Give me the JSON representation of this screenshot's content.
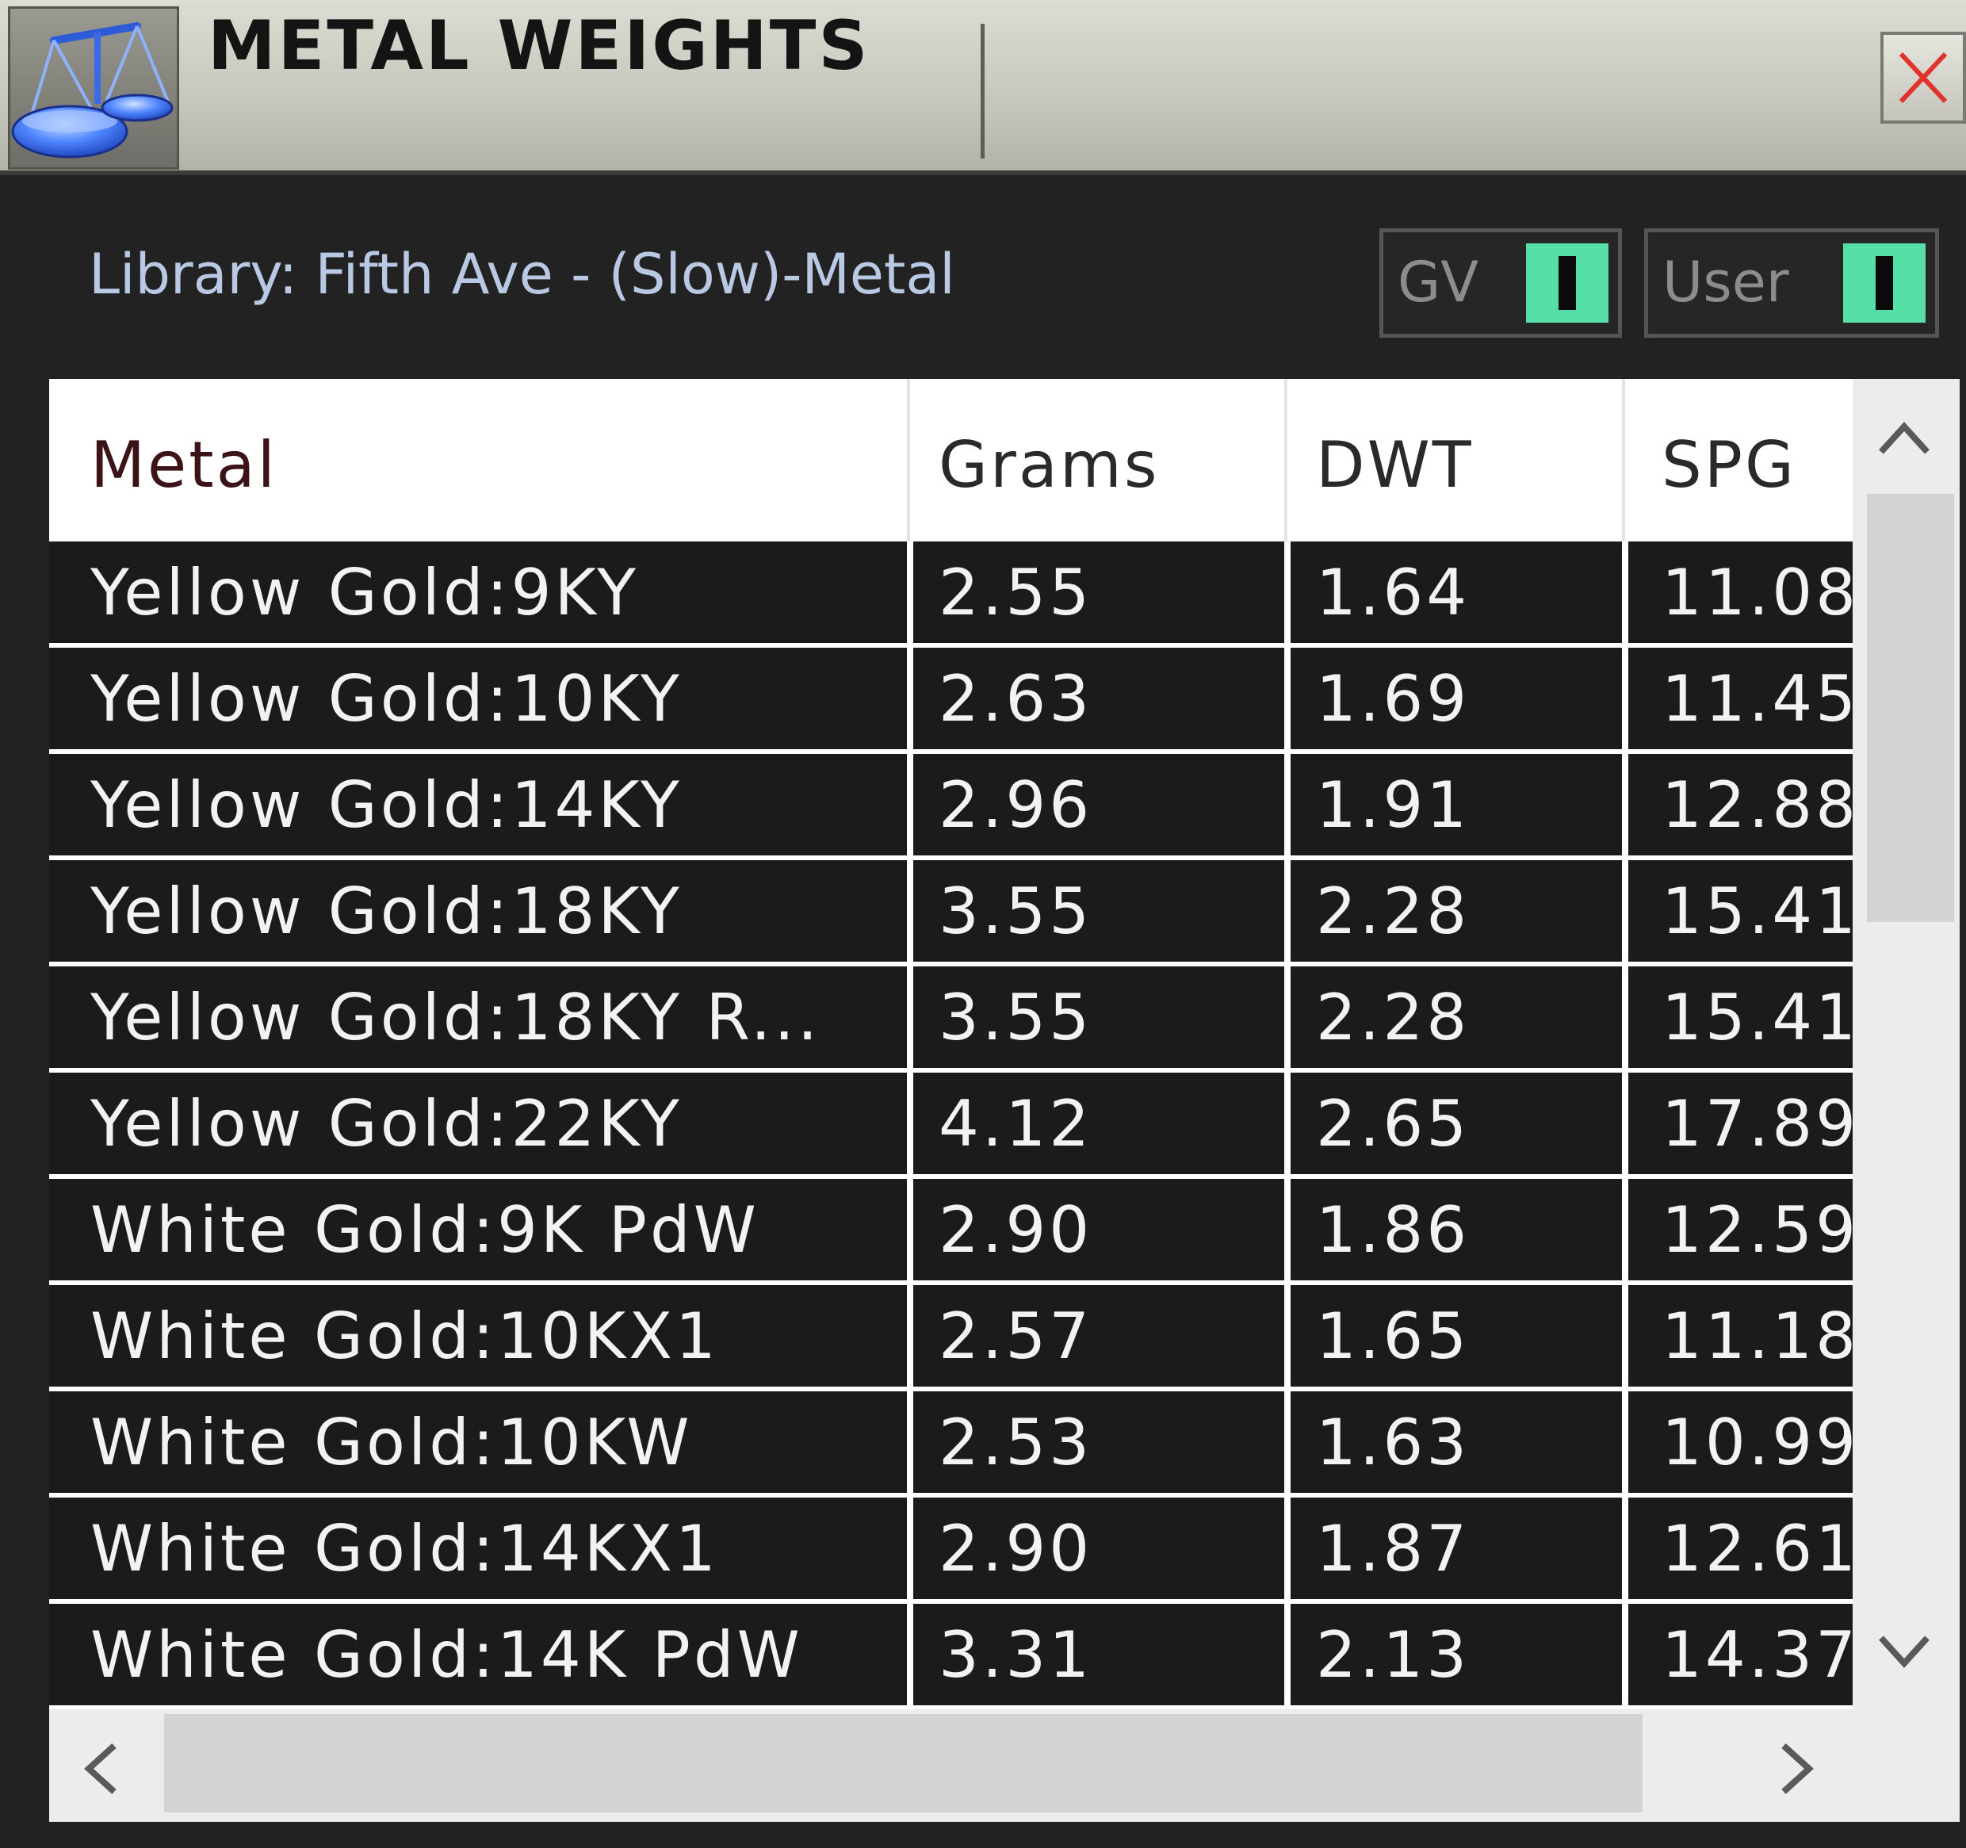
{
  "window": {
    "title": "METAL WEIGHTS",
    "app_icon": "scale-balance-icon",
    "close_icon": "close-icon"
  },
  "library": {
    "label": "Library: Fifth Ave - (Slow)-Metal"
  },
  "toggles": [
    {
      "label": "GV",
      "on": true,
      "color": "#56e0a8"
    },
    {
      "label": "User",
      "on": true,
      "color": "#56e0a8"
    }
  ],
  "table": {
    "columns": [
      "Metal",
      "Grams",
      "DWT",
      "SPG"
    ],
    "rows": [
      [
        "Yellow Gold:9KY",
        "2.55",
        "1.64",
        "11.08"
      ],
      [
        "Yellow Gold:10KY",
        "2.63",
        "1.69",
        "11.45"
      ],
      [
        "Yellow Gold:14KY",
        "2.96",
        "1.91",
        "12.88"
      ],
      [
        "Yellow Gold:18KY",
        "3.55",
        "2.28",
        "15.41"
      ],
      [
        "Yellow Gold:18KY R...",
        "3.55",
        "2.28",
        "15.41"
      ],
      [
        "Yellow Gold:22KY",
        "4.12",
        "2.65",
        "17.89"
      ],
      [
        "White Gold:9K PdW",
        "2.90",
        "1.86",
        "12.59"
      ],
      [
        "White Gold:10KX1",
        "2.57",
        "1.65",
        "11.18"
      ],
      [
        "White Gold:10KW",
        "2.53",
        "1.63",
        "10.99"
      ],
      [
        "White Gold:14KX1",
        "2.90",
        "1.87",
        "12.61"
      ],
      [
        "White Gold:14K PdW",
        "3.31",
        "2.13",
        "14.37"
      ]
    ]
  },
  "scrollbars": {
    "vertical": {
      "up_icon": "chevron-up-icon",
      "down_icon": "chevron-down-icon"
    },
    "horizontal": {
      "left_icon": "chevron-left-icon",
      "right_icon": "chevron-right-icon"
    }
  },
  "colors": {
    "row_background": "#1b1b1b",
    "row_text": "#f2f2f2",
    "library_text": "#b9c9e4",
    "toggle_on": "#56e0a8",
    "close_x": "#e0332b"
  }
}
